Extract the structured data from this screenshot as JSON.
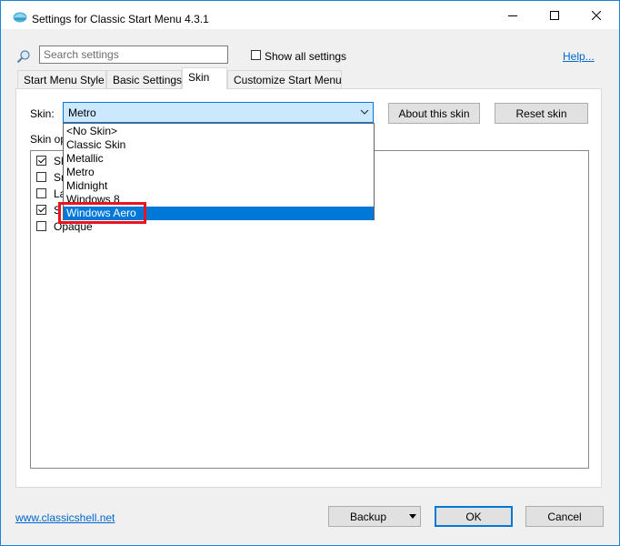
{
  "window": {
    "title": "Settings for Classic Start Menu 4.3.1",
    "accent": "#1883d7"
  },
  "toolbar": {
    "search_placeholder": "Search settings",
    "show_all_label": "Show all settings",
    "show_all_checked": false,
    "help_label": "Help..."
  },
  "tabs": [
    {
      "label": "Start Menu Style",
      "active": false
    },
    {
      "label": "Basic Settings",
      "active": false
    },
    {
      "label": "Skin",
      "active": true
    },
    {
      "label": "Customize Start Menu",
      "active": false
    }
  ],
  "skin": {
    "label": "Skin:",
    "selected": "Metro",
    "about_button": "About this skin",
    "reset_button": "Reset skin",
    "options_label": "Skin op",
    "options": [
      {
        "label": "Sh",
        "checked": true
      },
      {
        "label": "Sm",
        "checked": false
      },
      {
        "label": "La",
        "checked": false
      },
      {
        "label": "S",
        "checked": true
      },
      {
        "label": "Opaque",
        "checked": false
      }
    ]
  },
  "dropdown": {
    "items": [
      "<No Skin>",
      "Classic Skin",
      "Metallic",
      "Metro",
      "Midnight",
      "Windows 8",
      "Windows Aero"
    ],
    "highlighted": "Windows Aero",
    "highlight_color": "#0078d7",
    "annotation_color": "#e8141e"
  },
  "footer": {
    "link": "www.classicshell.net",
    "backup_button": "Backup",
    "ok_button": "OK",
    "cancel_button": "Cancel"
  }
}
